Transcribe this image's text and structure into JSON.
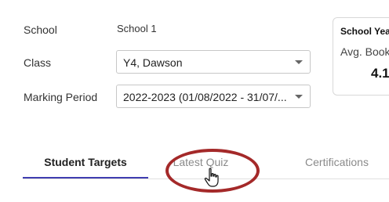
{
  "filters": {
    "school_label": "School",
    "school_value": "School 1",
    "class_label": "Class",
    "class_value": "Y4, Dawson",
    "marking_period_label": "Marking Period",
    "marking_period_value": "2022-2023 (01/08/2022 - 31/07/..."
  },
  "summary_card": {
    "title": "School Yea",
    "metric_label": "Avg. Book",
    "metric_value": "4.1"
  },
  "tabs": [
    {
      "label": "Student Targets",
      "active": true
    },
    {
      "label": "Latest Quiz",
      "active": false
    },
    {
      "label": "Certifications",
      "active": false
    }
  ],
  "colors": {
    "tab_active_underline": "#3f3db0",
    "highlight_annotation": "#a42929"
  },
  "icons": {
    "select_caret": "chevron-down-icon",
    "cursor": "hand-pointer-icon"
  }
}
